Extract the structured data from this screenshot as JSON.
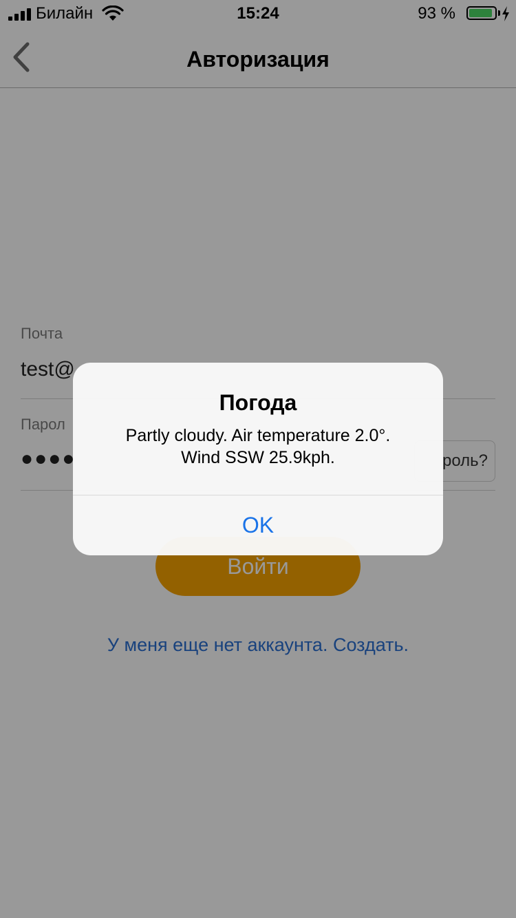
{
  "status_bar": {
    "carrier": "Билайн",
    "time": "15:24",
    "battery_percent": "93 %",
    "battery_level": 0.93,
    "battery_color": "#4cd964"
  },
  "nav": {
    "title": "Авторизация",
    "back_icon": "chevron-left-icon"
  },
  "form": {
    "email_label": "Почта",
    "email_value": "test@",
    "password_label": "Парол",
    "password_dots": "●●●●",
    "forgot_label": "роль?",
    "login_button": "Войти",
    "login_color": "#f6a200",
    "signup_link": "У меня еще нет аккаунта. Создать.",
    "link_color": "#2a6fd1"
  },
  "alert": {
    "title": "Погода",
    "message_line1": "Partly cloudy. Air temperature 2.0°.",
    "message_line2": "Wind SSW 25.9kph.",
    "ok_button": "OK",
    "ok_color": "#1a73e8"
  }
}
